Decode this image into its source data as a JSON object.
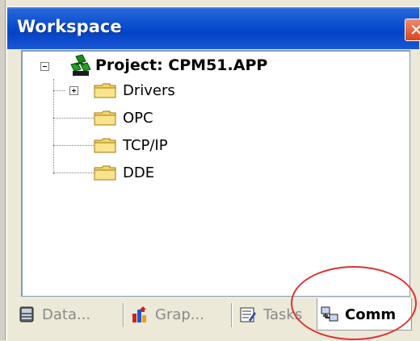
{
  "window": {
    "title": "Workspace",
    "close_glyph": "✕"
  },
  "tree": {
    "root": {
      "label": "Project: CPM51.APP",
      "icon": "project-icon",
      "expander": "minus"
    },
    "items": [
      {
        "label": "Drivers",
        "icon": "folder-icon",
        "expander": "plus"
      },
      {
        "label": "OPC",
        "icon": "folder-icon"
      },
      {
        "label": "TCP/IP",
        "icon": "folder-icon"
      },
      {
        "label": "DDE",
        "icon": "folder-icon"
      }
    ]
  },
  "tabs": [
    {
      "label": "Data...",
      "icon": "database-icon",
      "active": false
    },
    {
      "label": "Grap...",
      "icon": "graphics-icon",
      "active": false
    },
    {
      "label": "Tasks",
      "icon": "tasks-icon",
      "active": false
    },
    {
      "label": "Comm",
      "icon": "comm-icon",
      "active": true
    }
  ],
  "colors": {
    "title_bar": "#0a4fd0",
    "folder": "#f5d66a",
    "highlight": "#e03030"
  }
}
